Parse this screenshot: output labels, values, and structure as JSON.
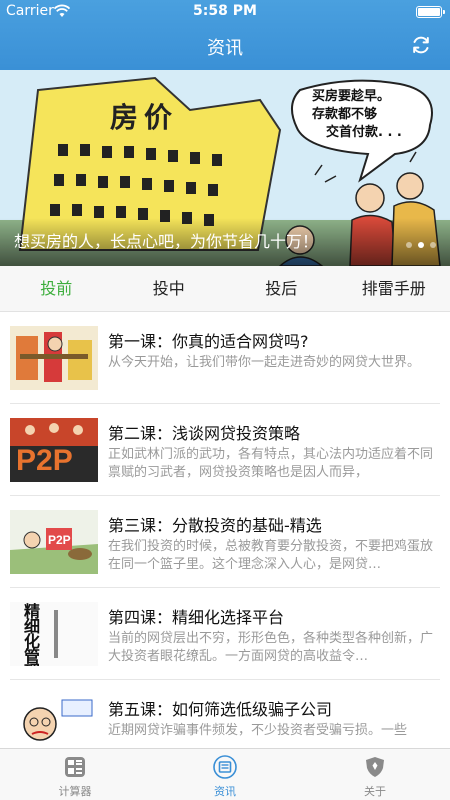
{
  "status_bar": {
    "carrier": "Carrier",
    "time": "5:58 PM"
  },
  "nav": {
    "title": "资讯",
    "refresh_icon": "refresh-icon"
  },
  "banner": {
    "caption": "想买房的人，长点心吧，为你节省几十万！",
    "sign_text": "房价",
    "speech_text": [
      "买房要趁早。",
      "存款都不够",
      "交首付款. . ."
    ],
    "dot_count": 3,
    "active_dot": 1
  },
  "tabs": [
    {
      "label": "投前",
      "active": true
    },
    {
      "label": "投中",
      "active": false
    },
    {
      "label": "投后",
      "active": false
    },
    {
      "label": "排雷手册",
      "active": false
    }
  ],
  "articles": [
    {
      "title": "第一课：你真的适合网贷吗?",
      "desc": "从今天开始，让我们带你一起走进奇妙的网贷大世界。"
    },
    {
      "title": "第二课：浅谈网贷投资策略",
      "desc": "正如武林门派的武功，各有特点，其心法内功适应着不同禀赋的习武者，网贷投资策略也是因人而异，"
    },
    {
      "title": "第三课：分散投资的基础-精选",
      "desc": "在我们投资的时候，总被教育要分散投资，不要把鸡蛋放在同一个篮子里。这个理念深入人心，是网贷…"
    },
    {
      "title": "第四课：精细化选择平台",
      "desc": "当前的网贷层出不穷，形形色色，各种类型各种创新，广大投资者眼花缭乱。一方面网贷的高收益令…"
    },
    {
      "title": "第五课：如何筛选低级骗子公司",
      "desc": "近期网贷诈骗事件频发，不少投资者受骗亏损。一些"
    }
  ],
  "thumb_text": {
    "p2p": "P2P",
    "refine": "精细化管理"
  },
  "tabbar": [
    {
      "label": "计算器",
      "icon": "calculator-icon",
      "active": false
    },
    {
      "label": "资讯",
      "icon": "news-icon",
      "active": true
    },
    {
      "label": "关于",
      "icon": "shield-icon",
      "active": false
    }
  ],
  "colors": {
    "header": "#3a90d6",
    "active_tab": "#3cae3c",
    "active_tabbar": "#3a8fd6"
  }
}
